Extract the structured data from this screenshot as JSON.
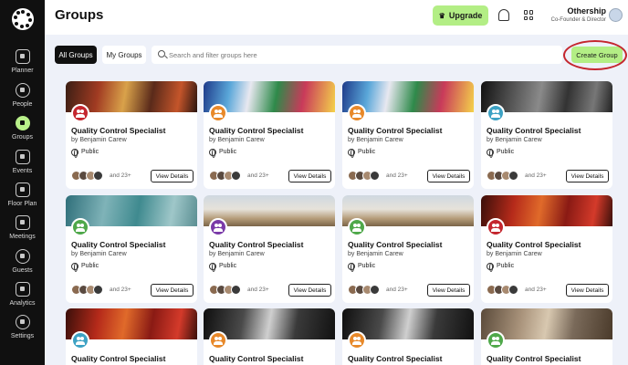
{
  "sidebar": {
    "items": [
      {
        "label": "Planner",
        "icon": "planner-icon"
      },
      {
        "label": "People",
        "icon": "people-icon"
      },
      {
        "label": "Groups",
        "icon": "groups-icon"
      },
      {
        "label": "Events",
        "icon": "events-icon"
      },
      {
        "label": "Floor Plan",
        "icon": "floor-plan-icon"
      },
      {
        "label": "Meetings",
        "icon": "meetings-icon"
      },
      {
        "label": "Guests",
        "icon": "guests-icon"
      },
      {
        "label": "Analytics",
        "icon": "analytics-icon"
      },
      {
        "label": "Settings",
        "icon": "settings-icon"
      }
    ],
    "active": "Groups"
  },
  "header": {
    "title": "Groups",
    "upgrade_label": "Upgrade",
    "user_name": "Othership",
    "user_role": "Co-Founder & Director"
  },
  "toolbar": {
    "tab_all": "All Groups",
    "tab_mine": "My Groups",
    "search_placeholder": "Search and filter groups here",
    "create_label": "Create Group"
  },
  "colors": {
    "accent": "#b3ee85",
    "sidebar": "#101010",
    "highlight": "#c4262e"
  },
  "cards": [
    {
      "title": "Quality Control Specialist",
      "by": "by Benjamin Carew",
      "visibility": "Public",
      "more": "and 23+",
      "button": "View Details"
    },
    {
      "title": "Quality Control Specialist",
      "by": "by Benjamin Carew",
      "visibility": "Public",
      "more": "and 23+",
      "button": "View Details"
    },
    {
      "title": "Quality Control Specialist",
      "by": "by Benjamin Carew",
      "visibility": "Public",
      "more": "and 23+",
      "button": "View Details"
    },
    {
      "title": "Quality Control Specialist",
      "by": "by Benjamin Carew",
      "visibility": "Public",
      "more": "and 23+",
      "button": "View Details"
    },
    {
      "title": "Quality Control Specialist",
      "by": "by Benjamin Carew",
      "visibility": "Public",
      "more": "and 23+",
      "button": "View Details"
    },
    {
      "title": "Quality Control Specialist",
      "by": "by Benjamin Carew",
      "visibility": "Public",
      "more": "and 23+",
      "button": "View Details"
    },
    {
      "title": "Quality Control Specialist",
      "by": "by Benjamin Carew",
      "visibility": "Public",
      "more": "and 23+",
      "button": "View Details"
    },
    {
      "title": "Quality Control Specialist",
      "by": "by Benjamin Carew",
      "visibility": "Public",
      "more": "and 23+",
      "button": "View Details"
    },
    {
      "title": "Quality Control Specialist"
    },
    {
      "title": "Quality Control Specialist"
    },
    {
      "title": "Quality Control Specialist"
    },
    {
      "title": "Quality Control Specialist"
    }
  ]
}
